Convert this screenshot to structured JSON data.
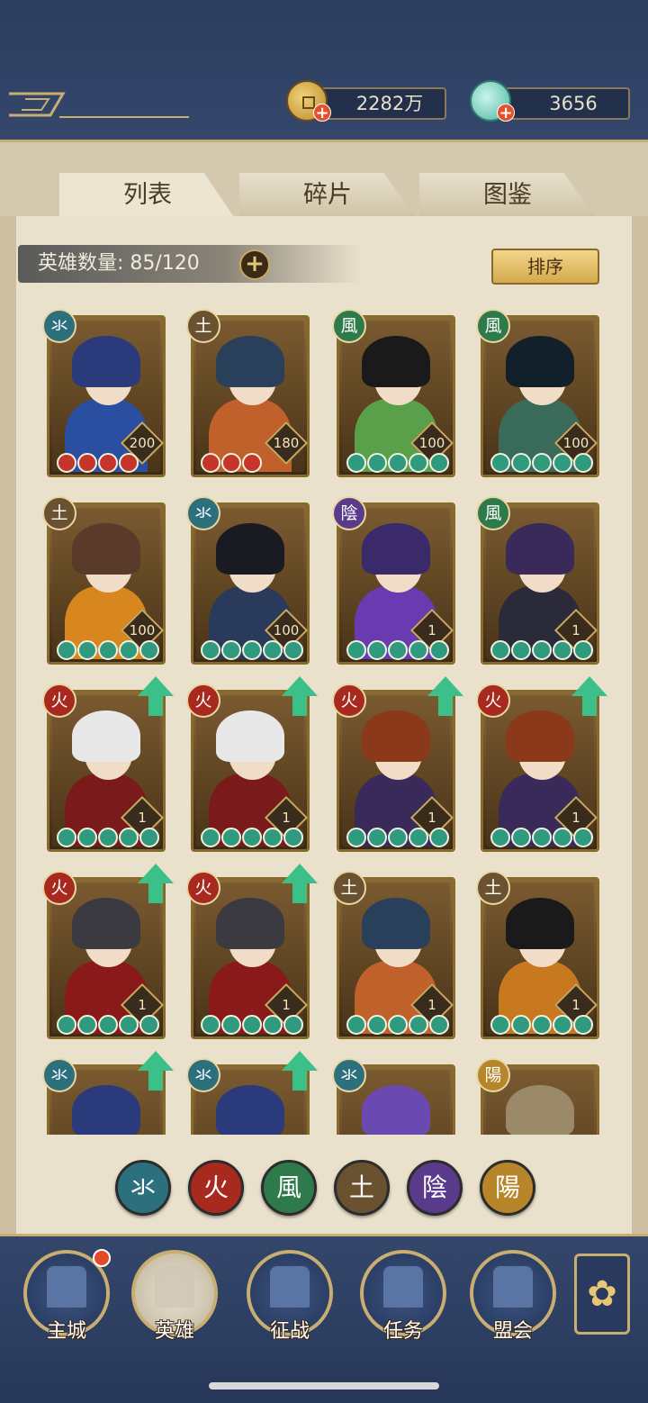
{
  "currency": {
    "coins": "2282万",
    "jade": "3656"
  },
  "tabs": [
    "列表",
    "碎片",
    "图鉴"
  ],
  "hero_count_label": "英雄数量: 85/120",
  "sort_label": "排序",
  "colors": {
    "water": "#2c6f7d",
    "fire": "#a8291e",
    "wind": "#2f7a4a",
    "earth": "#6a5230",
    "yin": "#5a3a8a",
    "yang": "#b8862a"
  },
  "heroes": [
    {
      "element": "氺",
      "el_key": "water",
      "level": "200",
      "stars": 4,
      "star_color": "red",
      "upgrade": false,
      "hair": "#2a3a7a",
      "cloth": "#2b4fa0"
    },
    {
      "element": "土",
      "el_key": "earth",
      "level": "180",
      "stars": 3,
      "star_color": "red",
      "upgrade": false,
      "hair": "#2a3f5a",
      "cloth": "#c0602a"
    },
    {
      "element": "風",
      "el_key": "wind",
      "level": "100",
      "stars": 5,
      "star_color": "green",
      "upgrade": false,
      "hair": "#1a1a1a",
      "cloth": "#5aa04a"
    },
    {
      "element": "風",
      "el_key": "wind",
      "level": "100",
      "stars": 5,
      "star_color": "green",
      "upgrade": false,
      "hair": "#12202a",
      "cloth": "#3a6a5a"
    },
    {
      "element": "土",
      "el_key": "earth",
      "level": "100",
      "stars": 5,
      "star_color": "green",
      "upgrade": false,
      "hair": "#5a3a2a",
      "cloth": "#d8861e"
    },
    {
      "element": "氺",
      "el_key": "water",
      "level": "100",
      "stars": 5,
      "star_color": "green",
      "upgrade": false,
      "hair": "#1a1a22",
      "cloth": "#2a3a5a"
    },
    {
      "element": "陰",
      "el_key": "yin",
      "level": "1",
      "stars": 5,
      "star_color": "green",
      "upgrade": false,
      "hair": "#3a2a6a",
      "cloth": "#6a3ab0"
    },
    {
      "element": "風",
      "el_key": "wind",
      "level": "1",
      "stars": 5,
      "star_color": "green",
      "upgrade": false,
      "hair": "#3a2a5a",
      "cloth": "#2a2a3a"
    },
    {
      "element": "火",
      "el_key": "fire",
      "level": "1",
      "stars": 5,
      "star_color": "green",
      "upgrade": true,
      "hair": "#e8e8e8",
      "cloth": "#7a1a1a"
    },
    {
      "element": "火",
      "el_key": "fire",
      "level": "1",
      "stars": 5,
      "star_color": "green",
      "upgrade": true,
      "hair": "#e8e8e8",
      "cloth": "#7a1a1a"
    },
    {
      "element": "火",
      "el_key": "fire",
      "level": "1",
      "stars": 5,
      "star_color": "green",
      "upgrade": true,
      "hair": "#8a3a1a",
      "cloth": "#3a2a5a"
    },
    {
      "element": "火",
      "el_key": "fire",
      "level": "1",
      "stars": 5,
      "star_color": "green",
      "upgrade": true,
      "hair": "#8a3a1a",
      "cloth": "#3a2a5a"
    },
    {
      "element": "火",
      "el_key": "fire",
      "level": "1",
      "stars": 5,
      "star_color": "green",
      "upgrade": true,
      "hair": "#3a3a40",
      "cloth": "#8a1a1a"
    },
    {
      "element": "火",
      "el_key": "fire",
      "level": "1",
      "stars": 5,
      "star_color": "green",
      "upgrade": true,
      "hair": "#3a3a40",
      "cloth": "#8a1a1a"
    },
    {
      "element": "土",
      "el_key": "earth",
      "level": "1",
      "stars": 5,
      "star_color": "green",
      "upgrade": false,
      "hair": "#2a3f5a",
      "cloth": "#c0602a"
    },
    {
      "element": "土",
      "el_key": "earth",
      "level": "1",
      "stars": 5,
      "star_color": "green",
      "upgrade": false,
      "hair": "#1a1a1a",
      "cloth": "#c8781e"
    },
    {
      "element": "氺",
      "el_key": "water",
      "level": "",
      "stars": 0,
      "star_color": "green",
      "upgrade": true,
      "hair": "#2a3a7a",
      "cloth": "#2b4fa0"
    },
    {
      "element": "氺",
      "el_key": "water",
      "level": "",
      "stars": 0,
      "star_color": "green",
      "upgrade": true,
      "hair": "#2a3a7a",
      "cloth": "#2b4fa0"
    },
    {
      "element": "氺",
      "el_key": "water",
      "level": "",
      "stars": 0,
      "star_color": "green",
      "upgrade": false,
      "hair": "#6a4ab0",
      "cloth": "#4a3a7a"
    },
    {
      "element": "陽",
      "el_key": "yang",
      "level": "",
      "stars": 0,
      "star_color": "green",
      "upgrade": false,
      "hair": "#9a8a6a",
      "cloth": "#6a5a3a"
    }
  ],
  "filters": [
    {
      "label": "氺",
      "key": "water"
    },
    {
      "label": "火",
      "key": "fire"
    },
    {
      "label": "風",
      "key": "wind"
    },
    {
      "label": "土",
      "key": "earth"
    },
    {
      "label": "陰",
      "key": "yin"
    },
    {
      "label": "陽",
      "key": "yang"
    }
  ],
  "nav": [
    {
      "label": "主城",
      "icon": "city-gate-icon"
    },
    {
      "label": "英雄",
      "icon": "hero-icon"
    },
    {
      "label": "征战",
      "icon": "battle-drum-icon"
    },
    {
      "label": "任务",
      "icon": "scroll-quest-icon"
    },
    {
      "label": "盟会",
      "icon": "alliance-pavilion-icon"
    }
  ],
  "more_icon": "menu-grid-icon"
}
